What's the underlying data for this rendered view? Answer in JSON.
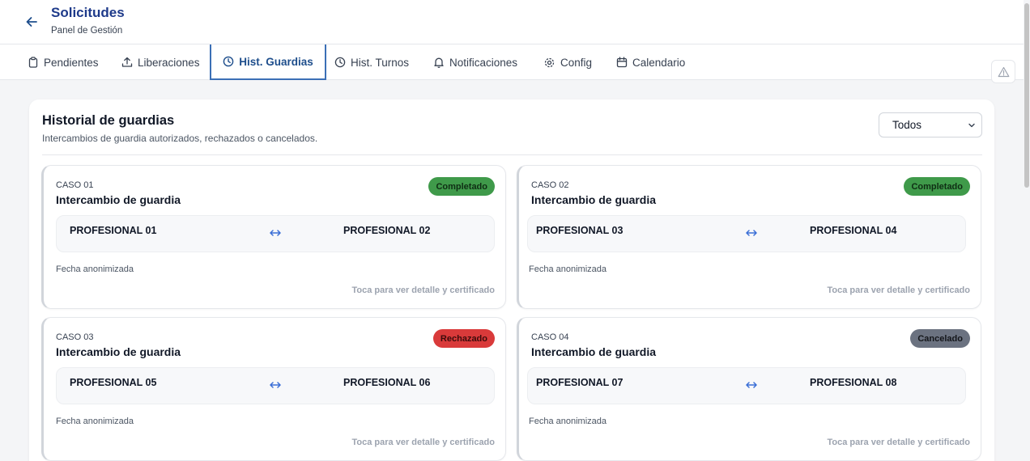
{
  "header": {
    "title": "Solicitudes",
    "subtitle": "Panel de Gestión"
  },
  "tabs": [
    {
      "label": "Pendientes",
      "icon": "clipboard-icon",
      "active": false
    },
    {
      "label": "Liberaciones",
      "icon": "upload-icon",
      "active": false
    },
    {
      "label": "Hist. Guardias",
      "icon": "clock-icon",
      "active": true
    },
    {
      "label": "Hist. Turnos",
      "icon": "clock-icon",
      "active": false
    },
    {
      "label": "Notificaciones",
      "icon": "bell-icon",
      "active": false
    },
    {
      "label": "Config",
      "icon": "gear-icon",
      "active": false
    },
    {
      "label": "Calendario",
      "icon": "calendar-icon",
      "active": false
    }
  ],
  "panel": {
    "title": "Historial de guardias",
    "description": "Intercambios de guardia autorizados, rechazados o cancelados.",
    "filter": {
      "selected": "Todos"
    }
  },
  "cards": [
    {
      "case": "CASO 01",
      "title": "Intercambio de guardia",
      "status": "Completado",
      "status_color": "#3f9a4a",
      "from": "PROFESIONAL 01",
      "to": "PROFESIONAL 02",
      "date": "Fecha anonimizada",
      "hint": "Toca para ver detalle y certificado"
    },
    {
      "case": "CASO 02",
      "title": "Intercambio de guardia",
      "status": "Completado",
      "status_color": "#3f9a4a",
      "from": "PROFESIONAL 03",
      "to": "PROFESIONAL 04",
      "date": "Fecha anonimizada",
      "hint": "Toca para ver detalle y certificado"
    },
    {
      "case": "CASO 03",
      "title": "Intercambio de guardia",
      "status": "Rechazado",
      "status_color": "#d93a3a",
      "from": "PROFESIONAL 05",
      "to": "PROFESIONAL 06",
      "date": "Fecha anonimizada",
      "hint": "Toca para ver detalle y certificado"
    },
    {
      "case": "CASO 04",
      "title": "Intercambio de guardia",
      "status": "Cancelado",
      "status_color": "#6b7280",
      "from": "PROFESIONAL 07",
      "to": "PROFESIONAL 08",
      "date": "Fecha anonimizada",
      "hint": "Toca para ver detalle y certificado"
    }
  ],
  "colors": {
    "brand": "#1e3a8a",
    "active_tab": "#3b6fb6",
    "swap_arrow": "#3b6fd6"
  }
}
